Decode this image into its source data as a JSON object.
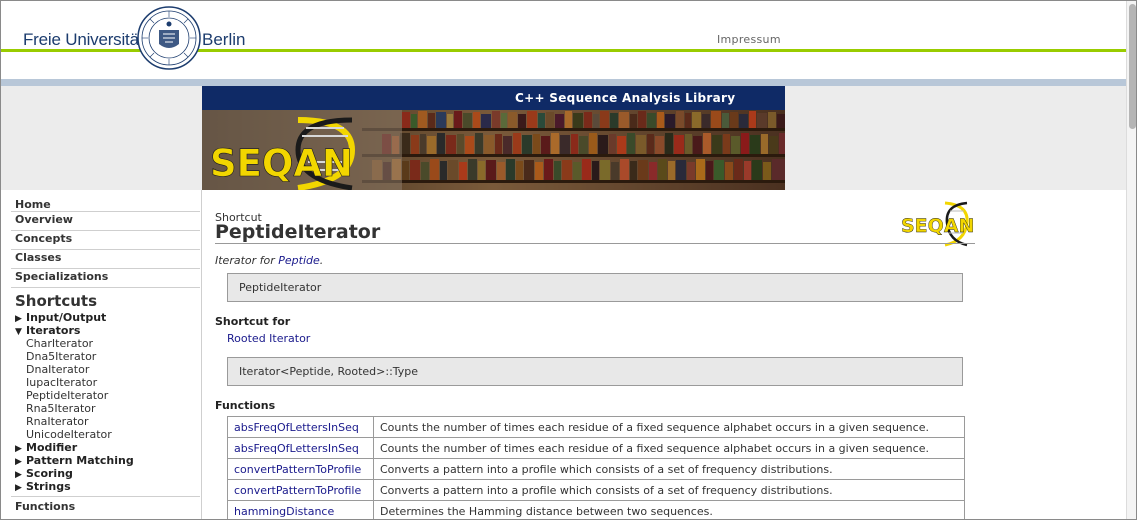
{
  "header": {
    "university_left": "Freie Universität",
    "university_right": "Berlin",
    "impressum": "Impressum"
  },
  "banner": {
    "title": "C++ Sequence Analysis Library",
    "logo_text": "SEQAN"
  },
  "sidebar": {
    "top_items": [
      "Home",
      "Overview",
      "Concepts",
      "Classes",
      "Specializations"
    ],
    "section_title": "Shortcuts",
    "groups": [
      {
        "label": "Input/Output",
        "expanded": false
      },
      {
        "label": "Iterators",
        "expanded": true,
        "children": [
          "CharIterator",
          "Dna5Iterator",
          "DnaIterator",
          "IupacIterator",
          "PeptideIterator",
          "Rna5Iterator",
          "RnaIterator",
          "UnicodeIterator"
        ]
      },
      {
        "label": "Modifier",
        "expanded": false
      },
      {
        "label": "Pattern Matching",
        "expanded": false
      },
      {
        "label": "Scoring",
        "expanded": false
      },
      {
        "label": "Strings",
        "expanded": false
      }
    ],
    "bottom_item": "Functions"
  },
  "content": {
    "kind": "Shortcut",
    "title": "PeptideIterator",
    "summary_prefix": "Iterator for ",
    "summary_link": "Peptide",
    "summary_suffix": ".",
    "signature": "PeptideIterator",
    "shortcut_for_heading": "Shortcut for",
    "shortcut_for_link": "Rooted Iterator",
    "expansion": "Iterator<Peptide, Rooted>::Type",
    "functions_heading": "Functions",
    "functions": [
      {
        "name": "absFreqOfLettersInSeq",
        "description": "Counts the number of times each residue of a fixed sequence alphabet occurs in a given sequence."
      },
      {
        "name": "absFreqOfLettersInSeq",
        "description": "Counts the number of times each residue of a fixed sequence alphabet occurs in a given sequence."
      },
      {
        "name": "convertPatternToProfile",
        "description": "Converts a pattern into a profile which consists of a set of frequency distributions."
      },
      {
        "name": "convertPatternToProfile",
        "description": "Converts a pattern into a profile which consists of a set of frequency distributions."
      },
      {
        "name": "hammingDistance",
        "description": "Determines the Hamming distance between two sequences."
      }
    ]
  },
  "colors": {
    "accent_green": "#99cc00",
    "banner_navy": "#0f2a66",
    "link_blue": "#1a1a8c",
    "logo_yellow": "#f2d600"
  }
}
